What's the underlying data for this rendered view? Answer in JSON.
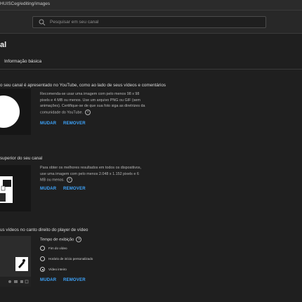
{
  "browser": {
    "url": "HUISCeg/editing/images"
  },
  "header": {
    "search_placeholder": "Pesquisar em seu canal"
  },
  "page": {
    "title": "al",
    "tab": "Informação básica"
  },
  "photo": {
    "title": "o seu canal é apresentado no YouTube, como ao lado de seus vídeos e comentários",
    "description": "Recomenda-se usar uma imagem com pelo menos 98 x 98 pixels e 4 MB ou menos. Use um arquivo PNG ou GIF (sem animações). Certifique-se de que sua foto siga as diretrizes da comunidade do YouTube.",
    "change": "MUDAR",
    "remove": "REMOVER"
  },
  "banner": {
    "title": "superior do seu canal",
    "description": "Para obter os melhores resultados em todos os dispositivos, use uma imagem com pelo menos 2.048 x 1.152 pixels e 6 MB ou menos.",
    "change": "MUDAR",
    "remove": "REMOVER"
  },
  "watermark": {
    "title": "us vídeos no canto direito do player de vídeo",
    "display_time_label": "Tempo de exibição",
    "options": [
      "Fim do vídeo",
      "Horário de início personalizado",
      "Vídeo inteiro"
    ],
    "selected": "Vídeo inteiro",
    "change": "MUDAR",
    "remove": "REMOVER"
  }
}
